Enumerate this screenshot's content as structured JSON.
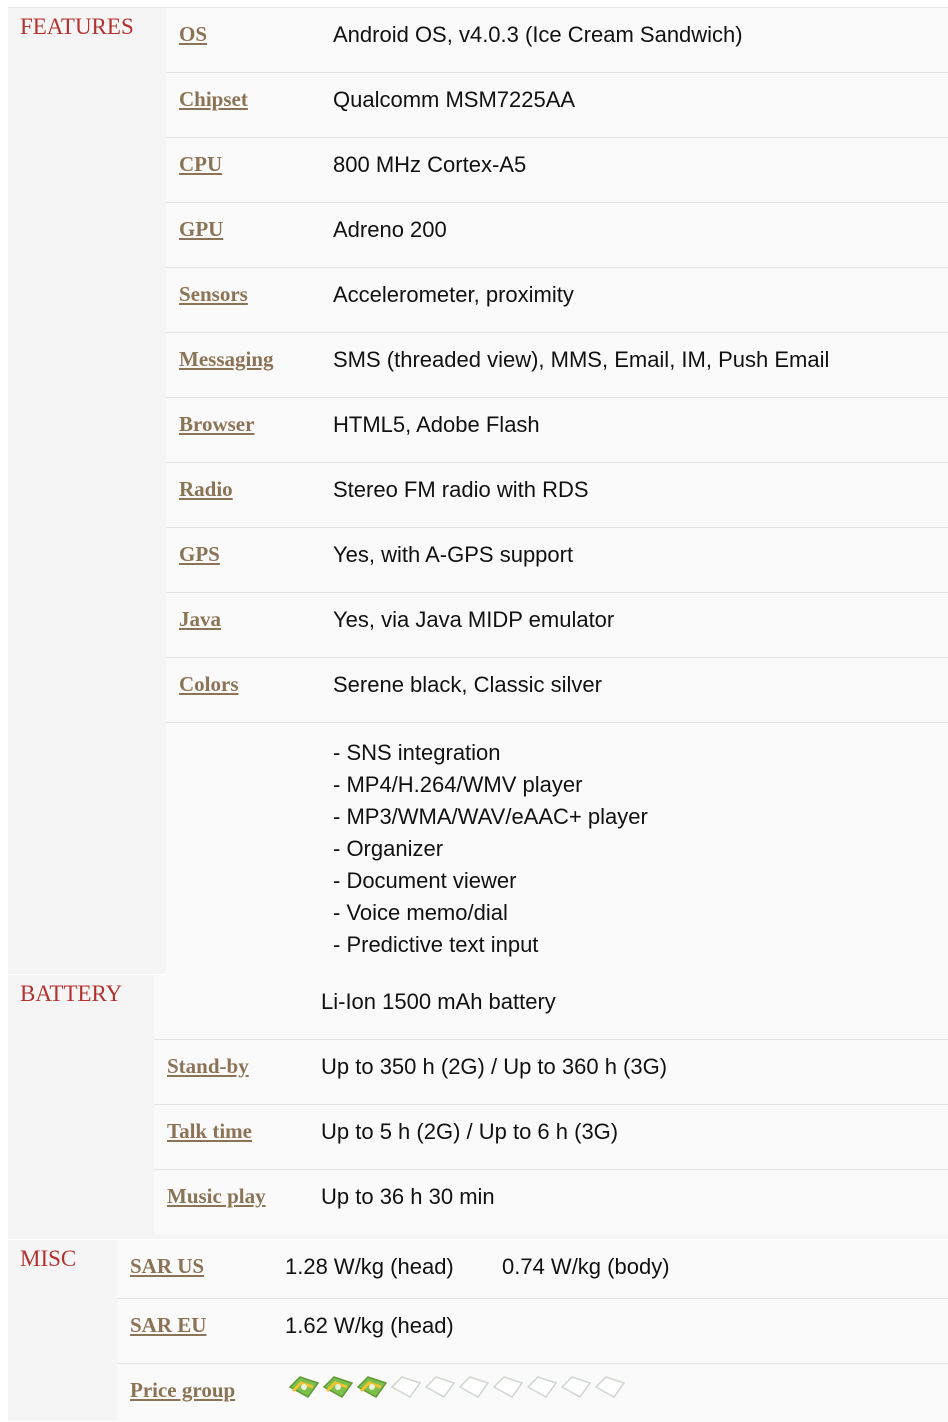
{
  "features": {
    "title": "FEATURES",
    "specs": [
      {
        "label": "OS",
        "value": "Android OS, v4.0.3 (Ice Cream Sandwich)"
      },
      {
        "label": "Chipset",
        "value": "Qualcomm MSM7225AA"
      },
      {
        "label": "CPU",
        "value": "800 MHz Cortex-A5"
      },
      {
        "label": "GPU",
        "value": "Adreno 200"
      },
      {
        "label": "Sensors",
        "value": "Accelerometer, proximity"
      },
      {
        "label": "Messaging",
        "value": "SMS (threaded view), MMS, Email, IM, Push Email"
      },
      {
        "label": "Browser",
        "value": "HTML5, Adobe Flash"
      },
      {
        "label": "Radio",
        "value": "Stereo FM radio with RDS"
      },
      {
        "label": "GPS",
        "value": "Yes, with A-GPS support"
      },
      {
        "label": "Java",
        "value": "Yes, via Java MIDP emulator"
      },
      {
        "label": "Colors",
        "value": "Serene black, Classic silver"
      }
    ],
    "extras": [
      "- SNS integration",
      "- MP4/H.264/WMV player",
      "- MP3/WMA/WAV/eAAC+ player",
      "- Organizer",
      "- Document viewer",
      "- Voice memo/dial",
      "- Predictive text input"
    ]
  },
  "battery": {
    "title": "BATTERY",
    "type_value": "Li-Ion 1500 mAh battery",
    "specs": [
      {
        "label": "Stand-by",
        "value": "Up to 350 h (2G) / Up to 360 h (3G)"
      },
      {
        "label": "Talk time",
        "value": "Up to 5 h (2G) / Up to 6 h (3G)"
      },
      {
        "label": "Music play",
        "value": "Up to 36 h 30 min"
      }
    ]
  },
  "misc": {
    "title": "MISC",
    "sar_us": {
      "label": "SAR US",
      "head": "1.28 W/kg (head)",
      "body": "0.74 W/kg (body)"
    },
    "sar_eu": {
      "label": "SAR EU",
      "value": "1.62 W/kg (head)"
    },
    "price_group": {
      "label": "Price group",
      "filled": 3,
      "total": 10,
      "icon": "money-icon"
    }
  },
  "colors": {
    "section_title": "#b2322f",
    "label_link": "#8b7355",
    "price_filled": "#7cbf4a",
    "price_empty": "#cfd6cf"
  }
}
